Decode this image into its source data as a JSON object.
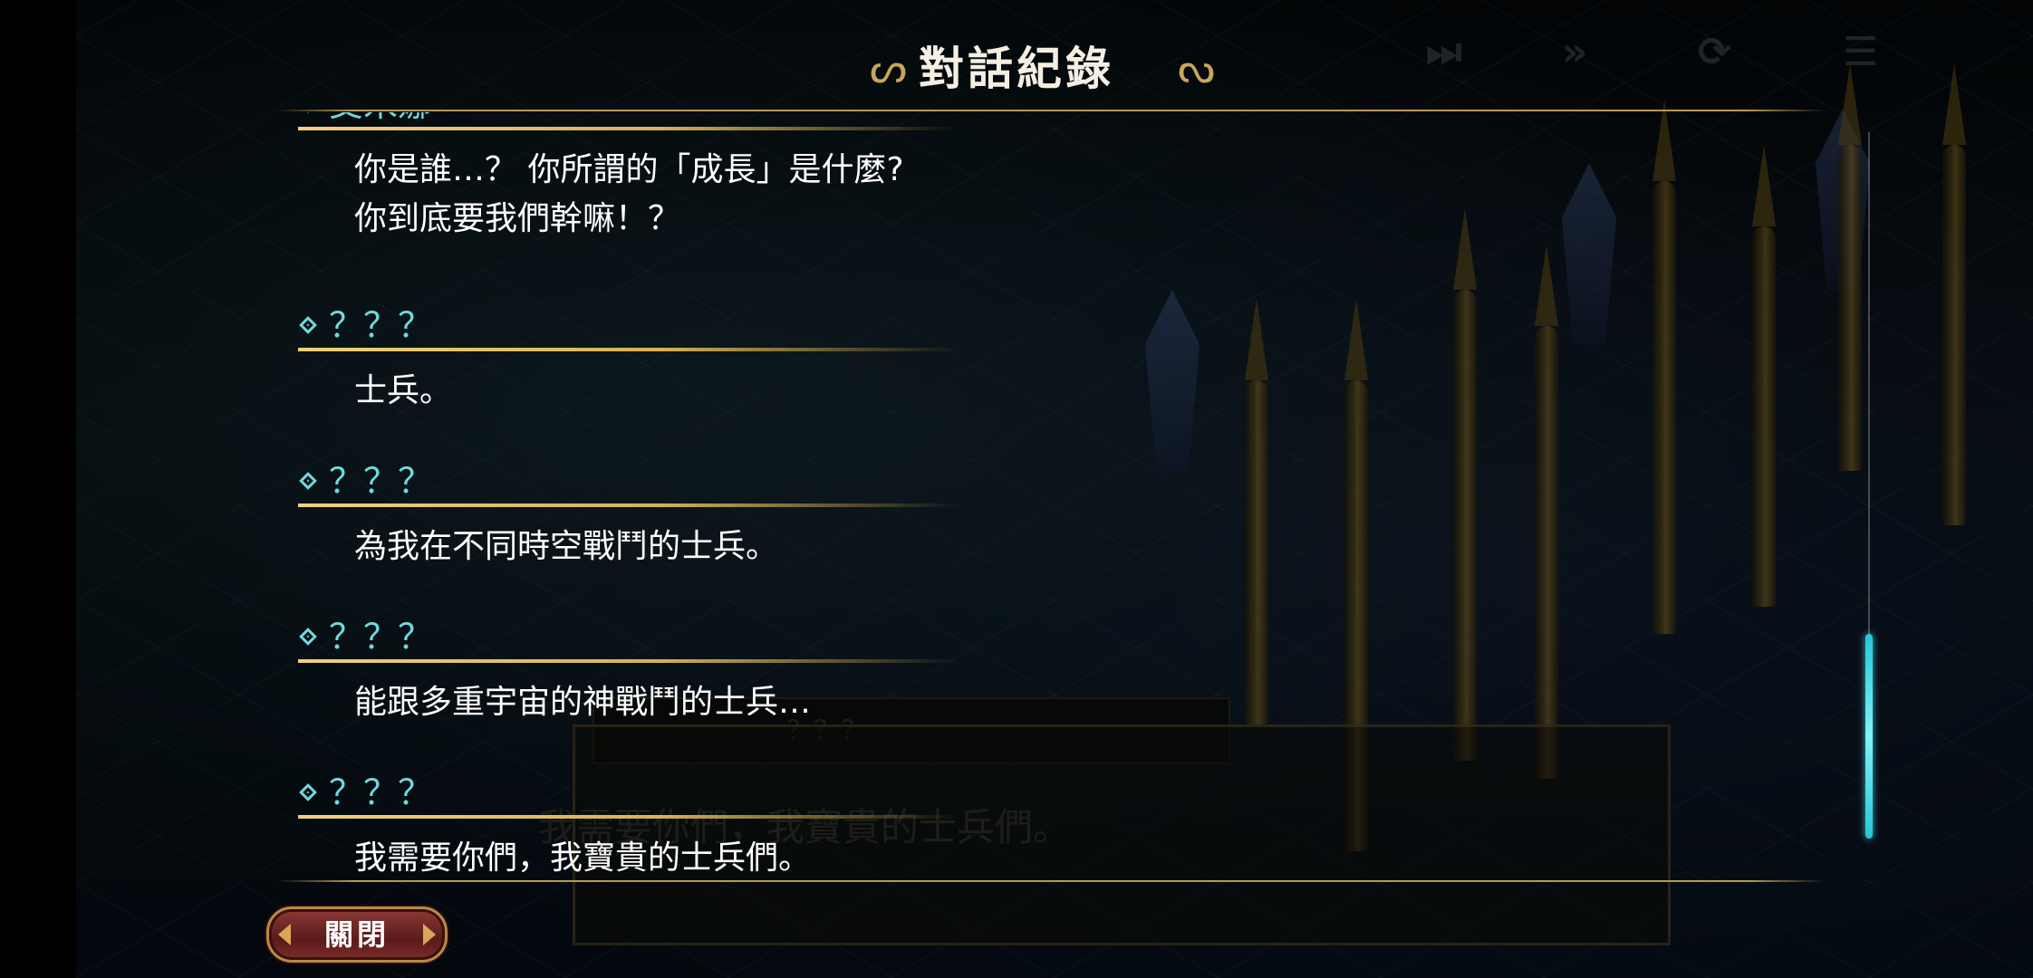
{
  "header": {
    "title": "對話紀錄"
  },
  "log": [
    {
      "speaker": "艾米娜",
      "lines": [
        "你是誰…？ 你所謂的「成長」是什麼?",
        "你到底要我們幹嘛！？"
      ]
    },
    {
      "speaker": "？？？",
      "lines": [
        "士兵。"
      ]
    },
    {
      "speaker": "？？？",
      "lines": [
        "為我在不同時空戰鬥的士兵。"
      ]
    },
    {
      "speaker": "？？？",
      "lines": [
        "能跟多重宇宙的神戰鬥的士兵…"
      ]
    },
    {
      "speaker": "？？？",
      "lines": [
        "我需要你們，我寶貴的士兵們。"
      ]
    }
  ],
  "background_dialog": {
    "speaker": "？？？",
    "text": "我需要你們，我寶貴的士兵們。"
  },
  "controls": {
    "skip_icon": "⏭",
    "fast_forward_icon": "»",
    "auto_icon": "⟳",
    "log_icon": "☰"
  },
  "close_button": {
    "label": "關閉"
  },
  "colors": {
    "speaker": "#6fd9dd",
    "accent_gold": "#d7b253",
    "scroll_thumb": "#25c7d8"
  }
}
